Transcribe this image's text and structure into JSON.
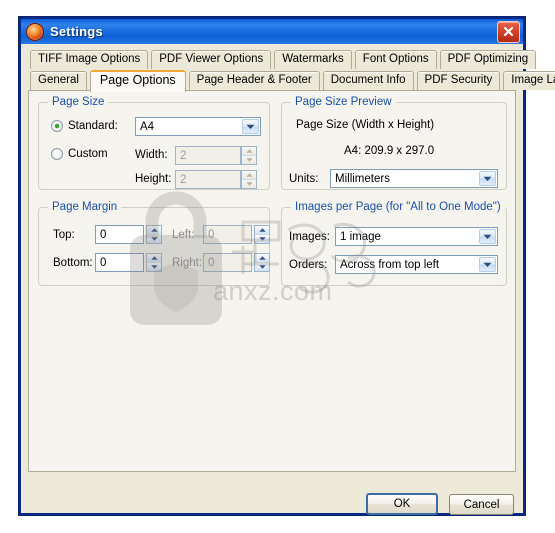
{
  "window": {
    "title": "Settings",
    "app_icon": "settings-orb-icon",
    "close_icon": "close-icon"
  },
  "tabs": {
    "row1": [
      {
        "label": "TIFF Image Options",
        "selected": false
      },
      {
        "label": "PDF Viewer Options",
        "selected": false
      },
      {
        "label": "Watermarks",
        "selected": false
      },
      {
        "label": "Font Options",
        "selected": false
      },
      {
        "label": "PDF Optimizing",
        "selected": false
      }
    ],
    "row2": [
      {
        "label": "General",
        "selected": false
      },
      {
        "label": "Page Options",
        "selected": true
      },
      {
        "label": "Page Header & Footer",
        "selected": false
      },
      {
        "label": "Document Info",
        "selected": false
      },
      {
        "label": "PDF Security",
        "selected": false
      },
      {
        "label": "Image Layout",
        "selected": false
      }
    ]
  },
  "page_size": {
    "legend": "Page Size",
    "standard_radio_label": "Standard:",
    "standard_selected": true,
    "standard_value": "A4",
    "custom_radio_label": "Custom",
    "custom_selected": false,
    "width_label": "Width:",
    "width_value": "2",
    "height_label": "Height:",
    "height_value": "2"
  },
  "page_size_preview": {
    "legend": "Page Size Preview",
    "caption": "Page Size (Width x Height)",
    "value": "A4: 209.9 x 297.0",
    "units_label": "Units:",
    "units_value": "Millimeters"
  },
  "page_margin": {
    "legend": "Page Margin",
    "top_label": "Top:",
    "top_value": "0",
    "bottom_label": "Bottom:",
    "bottom_value": "0",
    "left_label": "Left:",
    "left_value": "0",
    "right_label": "Right:",
    "right_value": "0"
  },
  "images_per_page": {
    "legend": "Images per Page (for \"All to One Mode\")",
    "images_label": "Images:",
    "images_value": "1 image",
    "orders_label": "Orders:",
    "orders_value": "Across from top left"
  },
  "footer": {
    "ok_label": "OK",
    "cancel_label": "Cancel"
  },
  "watermark": {
    "site_text": "anxz.com",
    "lock_icon": "padlock-watermark-icon"
  },
  "colors": {
    "titlebar_blue": "#1669de",
    "group_legend_blue": "#1c4fa8",
    "selected_tab_accent": "#f0a830",
    "dialog_face": "#ece9d8",
    "tab_page": "#f5f4ef",
    "radio_dot_green": "#2faa2f",
    "close_red": "#d6412a"
  }
}
